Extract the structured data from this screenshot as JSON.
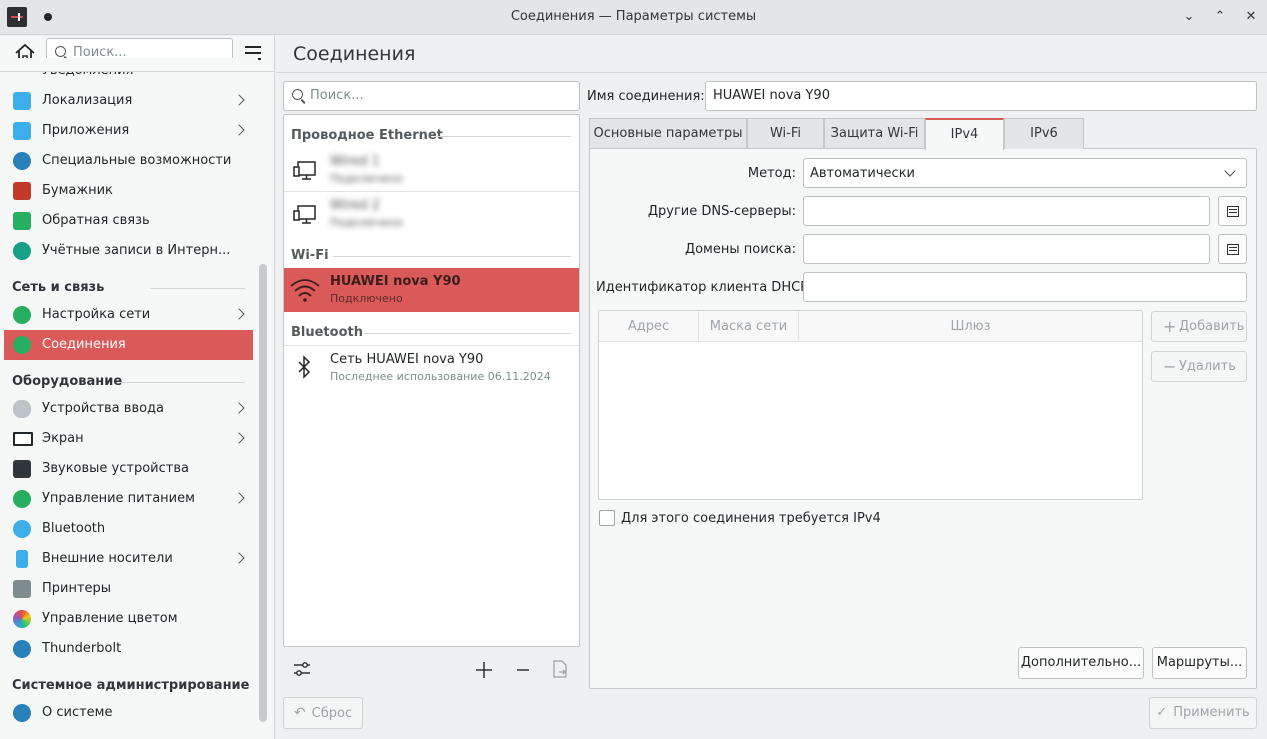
{
  "window": {
    "title": "Соединения — Параметры системы",
    "minimize": "⌄",
    "maximize": "⌃",
    "close": "✕"
  },
  "sidebar": {
    "search_placeholder": "Поиск...",
    "partial_item": "Уведомления",
    "items_top": [
      {
        "label": "Локализация",
        "icon": "localization-icon",
        "color": "#3daee9",
        "chevron": true
      },
      {
        "label": "Приложения",
        "icon": "apps-icon",
        "color": "#3daee9",
        "chevron": true
      },
      {
        "label": "Специальные возможности",
        "icon": "accessibility-icon",
        "color": "#2980b9",
        "chevron": false
      },
      {
        "label": "Бумажник",
        "icon": "wallet-icon",
        "color": "#c0392b",
        "chevron": false
      },
      {
        "label": "Обратная связь",
        "icon": "feedback-icon",
        "color": "#27ae60",
        "chevron": false
      },
      {
        "label": "Учётные записи в Интерн...",
        "icon": "online-accounts-icon",
        "color": "#16a085",
        "chevron": false
      }
    ],
    "section_network": "Сеть и связь",
    "items_network": [
      {
        "label": "Настройка сети",
        "icon": "network-settings-icon",
        "color": "#27ae60",
        "chevron": true
      },
      {
        "label": "Соединения",
        "icon": "connections-icon",
        "color": "#27ae60",
        "chevron": false
      }
    ],
    "section_hardware": "Оборудование",
    "items_hardware": [
      {
        "label": "Устройства ввода",
        "icon": "mouse-icon",
        "color": "#bdc3c7",
        "chevron": true
      },
      {
        "label": "Экран",
        "icon": "display-icon",
        "color": "#232629",
        "chevron": true
      },
      {
        "label": "Звуковые устройства",
        "icon": "speaker-icon",
        "color": "#31363b",
        "chevron": false
      },
      {
        "label": "Управление питанием",
        "icon": "power-icon",
        "color": "#27ae60",
        "chevron": true
      },
      {
        "label": "Bluetooth",
        "icon": "bluetooth-icon",
        "color": "#3daee9",
        "chevron": false
      },
      {
        "label": "Внешние носители",
        "icon": "usb-icon",
        "color": "#3daee9",
        "chevron": true
      },
      {
        "label": "Принтеры",
        "icon": "printer-icon",
        "color": "#7f8c8d",
        "chevron": false
      },
      {
        "label": "Управление цветом",
        "icon": "color-icon",
        "color": "#8e44ad",
        "chevron": false
      },
      {
        "label": "Thunderbolt",
        "icon": "thunderbolt-icon",
        "color": "#2980b9",
        "chevron": false
      }
    ],
    "section_admin": "Системное администрирование",
    "items_admin": [
      {
        "label": "О системе",
        "icon": "info-icon",
        "color": "#2980b9",
        "chevron": false
      }
    ]
  },
  "page": {
    "title": "Соединения"
  },
  "connections": {
    "search_placeholder": "Поиск...",
    "group_ethernet": "Проводное Ethernet",
    "ethernet": [
      {
        "name": "Wired 1",
        "status": "Подключено"
      },
      {
        "name": "Wired 2",
        "status": "Подключено"
      }
    ],
    "group_wifi": "Wi-Fi",
    "wifi": [
      {
        "name": "HUAWEI nova Y90",
        "status": "Подключено"
      }
    ],
    "group_bluetooth": "Bluetooth",
    "bluetooth": [
      {
        "name": "Сеть HUAWEI nova Y90",
        "status": "Последнее использование 06.11.2024"
      }
    ]
  },
  "details": {
    "name_label": "Имя соединения:",
    "name_value": "HUAWEI nova Y90",
    "tabs": [
      "Основные параметры",
      "Wi-Fi",
      "Защита Wi-Fi",
      "IPv4",
      "IPv6"
    ],
    "active_tab": "IPv4",
    "method_label": "Метод:",
    "method_value": "Автоматически",
    "dns_label": "Другие DNS-серверы:",
    "domains_label": "Домены поиска:",
    "dhcp_label": "Идентификатор клиента DHCP:",
    "table_headers": [
      "Адрес",
      "Маска сети",
      "Шлюз"
    ],
    "add_label": "Добавить",
    "remove_label": "Удалить",
    "require_label": "Для этого соединения требуется IPv4",
    "advanced_label": "Дополнительно...",
    "routes_label": "Маршруты...",
    "reset_label": "Сброс",
    "apply_label": "Применить"
  },
  "accent": "#da5959"
}
